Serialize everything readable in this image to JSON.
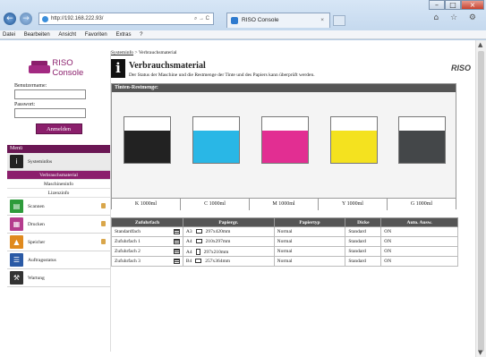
{
  "browser": {
    "address": "http://192.168.222.93/",
    "address_controls": "⌕ → C",
    "tab_title": "RISO Console",
    "tab_close": "×",
    "window_controls": [
      "–",
      "□",
      "×"
    ],
    "toolbar_icons": "⌂ ☆ ⚙",
    "menu": [
      "Datei",
      "Bearbeiten",
      "Ansicht",
      "Favoriten",
      "Extras",
      "?"
    ]
  },
  "sidebar": {
    "logo_text": "RISO Console",
    "username_label": "Benutzername:",
    "password_label": "Passwort:",
    "login_button": "Anmelden",
    "menu_label": "Menü",
    "items": [
      {
        "label": "Systeminfos",
        "icon": "info-icon",
        "locked": false
      },
      {
        "label": "Scannen",
        "icon": "scan-icon",
        "locked": true
      },
      {
        "label": "Drucken",
        "icon": "print-icon",
        "locked": true
      },
      {
        "label": "Speicher",
        "icon": "storage-icon",
        "locked": true
      },
      {
        "label": "Auftragsstatus",
        "icon": "job-status-icon",
        "locked": false
      },
      {
        "label": "Wartung",
        "icon": "maintenance-icon",
        "locked": false
      }
    ],
    "submenu": [
      "Verbrauchsmaterial",
      "Maschineninfo",
      "Lizenzinfo"
    ]
  },
  "main": {
    "breadcrumb_link": "Systeminfo",
    "breadcrumb_rest": " > Verbrauchsmaterial",
    "title": "Verbrauchsmaterial",
    "description": "Der Status der Maschine und die Restmenge der Tinte und des Papiers kann überprüft werden.",
    "brand": "RISO",
    "ink_header": "Tinten-Restmenge:",
    "inks": [
      {
        "label": "K 1000ml",
        "color": "#222222",
        "level": 0.7
      },
      {
        "label": "C 1000ml",
        "color": "#29b7e6",
        "level": 0.7
      },
      {
        "label": "M 1000ml",
        "color": "#e22e92",
        "level": 0.7
      },
      {
        "label": "Y 1000ml",
        "color": "#f4e21f",
        "level": 0.7
      },
      {
        "label": "G  1000ml",
        "color": "#444749",
        "level": 0.7
      }
    ],
    "tray_headers": [
      "Zufuhrfach",
      "Papiergr.",
      "Papiertyp",
      "Dicke",
      "Auto. Ausw."
    ],
    "trays": [
      {
        "name": "Standardfach",
        "size": "A3",
        "dims": "297x420mm",
        "orientation": "landscape",
        "type": "Normal",
        "thickness": "Standard",
        "auto": "ON"
      },
      {
        "name": "Zufuhrfach 1",
        "size": "A4",
        "dims": "210x297mm",
        "orientation": "landscape",
        "type": "Normal",
        "thickness": "Standard",
        "auto": "ON"
      },
      {
        "name": "Zufuhrfach 2",
        "size": "A4",
        "dims": "297x210mm",
        "orientation": "portrait",
        "type": "Normal",
        "thickness": "Standard",
        "auto": "ON"
      },
      {
        "name": "Zufuhrfach 3",
        "size": "B4",
        "dims": "257x364mm",
        "orientation": "landscape",
        "type": "Normal",
        "thickness": "Standard",
        "auto": "ON"
      }
    ]
  }
}
